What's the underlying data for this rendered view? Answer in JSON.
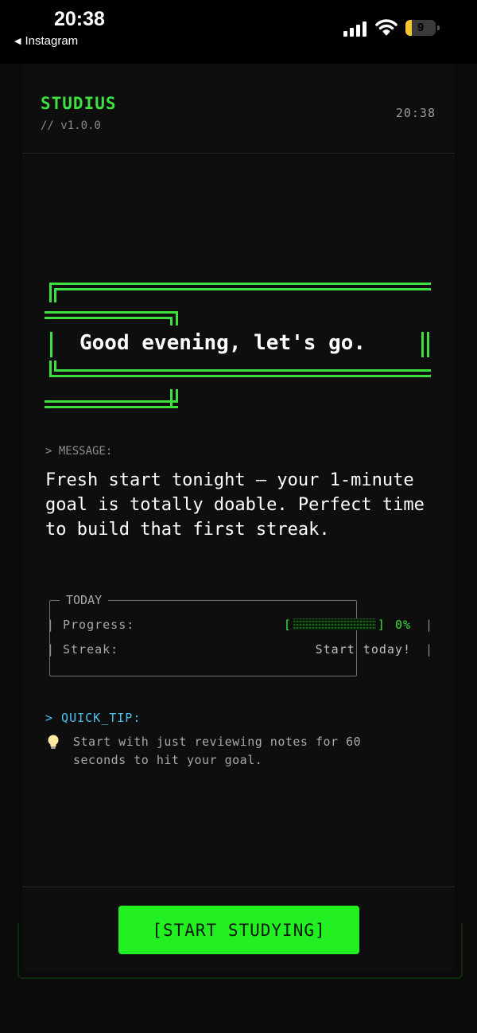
{
  "status_bar": {
    "time": "20:38",
    "back_label": "Instagram",
    "battery_level": "9",
    "battery_fraction": 0.12
  },
  "header": {
    "app_name": "STUDIUS",
    "version": "// v1.0.0",
    "clock": "20:38"
  },
  "greeting": "Good evening, let's go.",
  "message": {
    "label": "> MESSAGE:",
    "text": "Fresh start tonight — your 1-minute goal is totally doable. Perfect time to build that first streak."
  },
  "today": {
    "title": "TODAY",
    "progress_label": "Progress:",
    "progress_open": "[",
    "progress_close": "]",
    "progress_value": "0%",
    "progress_fraction": 0,
    "streak_label": "Streak:",
    "streak_value": "Start today!"
  },
  "tip": {
    "label": "> QUICK_TIP:",
    "text": "Start with just reviewing notes for 60 seconds to hit your goal.",
    "icon": "lightbulb-icon"
  },
  "cta": {
    "label": "[START STUDYING]"
  },
  "colors": {
    "accent_green": "#3de03d",
    "button_green": "#22f022",
    "tip_blue": "#4cc3f0",
    "background": "#0e0e0e"
  }
}
